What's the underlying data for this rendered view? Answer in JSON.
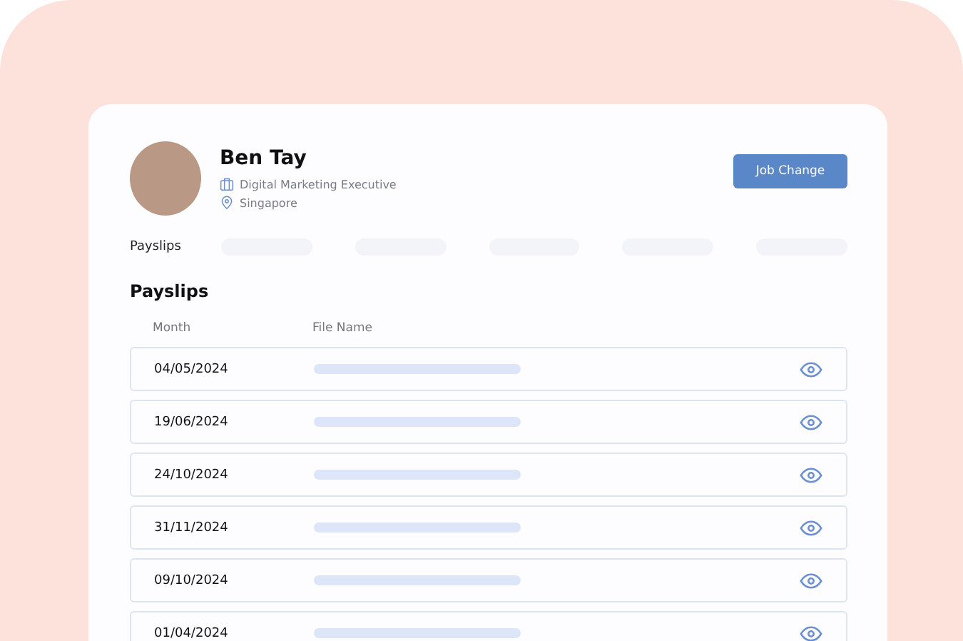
{
  "profile": {
    "name": "Ben Tay",
    "job_title": "Digital Marketing Executive",
    "location": "Singapore"
  },
  "action_button": "Job Change",
  "tab_bar": {
    "label": "Payslips",
    "other_tabs": [
      {
        "kind": "placeholder"
      },
      {
        "kind": "placeholder"
      },
      {
        "kind": "placeholder"
      },
      {
        "kind": "placeholder"
      },
      {
        "kind": "placeholder"
      }
    ]
  },
  "payslips": {
    "title": "Payslips",
    "columns": [
      "Month",
      "File Name"
    ],
    "rows": [
      {
        "month": "04/05/2024"
      },
      {
        "month": "19/06/2024"
      },
      {
        "month": "24/10/2024"
      },
      {
        "month": "31/11/2024"
      },
      {
        "month": "09/10/2024"
      },
      {
        "month": "01/04/2024"
      }
    ]
  }
}
